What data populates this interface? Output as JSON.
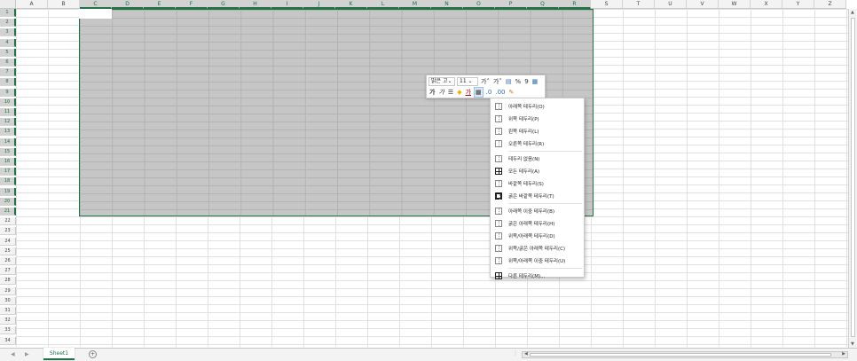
{
  "columns": [
    "A",
    "B",
    "C",
    "D",
    "E",
    "F",
    "G",
    "H",
    "I",
    "J",
    "K",
    "L",
    "M",
    "N",
    "O",
    "P",
    "Q",
    "R",
    "S",
    "T",
    "U",
    "V",
    "W",
    "X",
    "Y",
    "Z"
  ],
  "selected_columns": [
    "C",
    "D",
    "E",
    "F",
    "G",
    "H",
    "I",
    "J",
    "K",
    "L",
    "M",
    "N",
    "O",
    "P",
    "Q",
    "R"
  ],
  "rows": [
    "1",
    "2",
    "3",
    "4",
    "5",
    "6",
    "7",
    "8",
    "9",
    "10",
    "11",
    "12",
    "13",
    "14",
    "15",
    "16",
    "17",
    "18",
    "19",
    "20",
    "21",
    "22",
    "23",
    "24",
    "25",
    "26",
    "27",
    "28",
    "29",
    "30",
    "31",
    "32",
    "33",
    "34"
  ],
  "selected_rows_last": 21,
  "mini_toolbar": {
    "font_name": "맑은 고",
    "font_size": "11",
    "increase_font": "가˄",
    "decrease_font": "가˅",
    "percent": "%",
    "comma": "9",
    "bold": "가",
    "italic": "가",
    "align": "☰",
    "fill_color": "◆",
    "font_color": "가",
    "borders_icon": "▦",
    "decrease_decimal": ".00",
    "increase_decimal": ".0",
    "brush": "🖌"
  },
  "borders_menu": {
    "items": [
      {
        "label": "아래쪽 테두리(O)",
        "icon": "bottom-border-icon",
        "style": "normal"
      },
      {
        "label": "위쪽 테두리(P)",
        "icon": "top-border-icon",
        "style": "normal"
      },
      {
        "label": "왼쪽 테두리(L)",
        "icon": "left-border-icon",
        "style": "normal"
      },
      {
        "label": "오른쪽 테두리(R)",
        "icon": "right-border-icon",
        "style": "normal"
      },
      {
        "sep": true
      },
      {
        "label": "테두리 없음(N)",
        "icon": "no-border-icon",
        "style": "normal"
      },
      {
        "label": "모든 테두리(A)",
        "icon": "all-borders-icon",
        "style": "all"
      },
      {
        "label": "바깥쪽 테두리(S)",
        "icon": "outside-borders-icon",
        "style": "normal"
      },
      {
        "label": "굵은 바깥쪽 테두리(T)",
        "icon": "thick-outside-borders-icon",
        "style": "thick"
      },
      {
        "sep": true
      },
      {
        "label": "아래쪽 이중 테두리(B)",
        "icon": "bottom-double-border-icon",
        "style": "normal"
      },
      {
        "label": "굵은 아래쪽 테두리(H)",
        "icon": "thick-bottom-border-icon",
        "style": "normal"
      },
      {
        "label": "위쪽/아래쪽 테두리(D)",
        "icon": "top-bottom-border-icon",
        "style": "normal"
      },
      {
        "label": "위쪽/굵은 아래쪽 테두리(C)",
        "icon": "top-thick-bottom-border-icon",
        "style": "normal"
      },
      {
        "label": "위쪽/아래쪽 이중 테두리(U)",
        "icon": "top-double-bottom-border-icon",
        "style": "normal"
      },
      {
        "sep": true
      },
      {
        "label": "다른 테두리(M)...",
        "icon": "more-borders-icon",
        "style": "all"
      }
    ]
  },
  "sheet_tab": "Sheet1",
  "add_sheet": "+",
  "accent_color": "#217346"
}
